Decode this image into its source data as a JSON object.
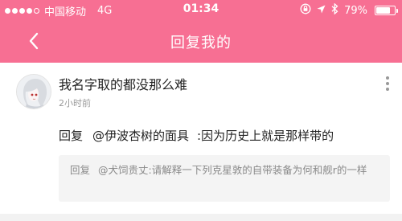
{
  "status_bar": {
    "carrier": "中国移动",
    "network": "4G",
    "time": "01:34",
    "battery_text": "79%",
    "battery_level": 0.79,
    "icons": [
      "signal-dots-icon",
      "rotation-lock-icon",
      "location-arrow-icon",
      "bluetooth-icon",
      "battery-icon"
    ]
  },
  "nav": {
    "title": "回复我的",
    "back_icon": "chevron-left-icon"
  },
  "comment": {
    "username": "我名字取的都没那么难",
    "time_ago": "2小时前",
    "reply_label": "回复",
    "mention": "@伊波杏树的面具",
    "content": ":因为历史上就是那样带的",
    "more_icon": "more-vertical-icon"
  },
  "quote": {
    "reply_label": "回复",
    "mention": "@犬饲贵丈:",
    "content": "请解释一下列克星敦的自带装备为何和舰r的一样"
  },
  "colors": {
    "accent": "#f76f93",
    "quote_bg": "#f4f4f4",
    "secondary_text": "#999999"
  }
}
